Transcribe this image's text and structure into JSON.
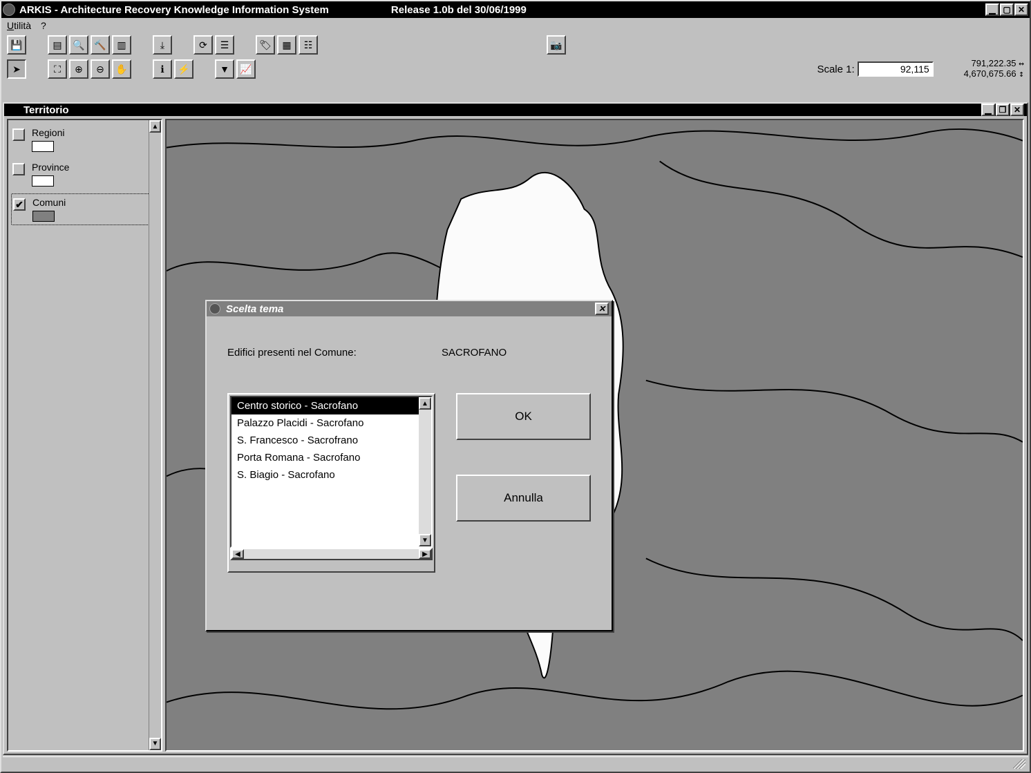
{
  "app": {
    "title": "ARKIS - Architecture Recovery Knowledge Information System",
    "release": "Release 1.0b  del 30/06/1999"
  },
  "menu": {
    "utilita": "Utilità",
    "help": "?"
  },
  "scale": {
    "label": "Scale 1:",
    "value": "92,115"
  },
  "coords": {
    "x": "791,222.35",
    "y": "4,670,675.66"
  },
  "child": {
    "title": "Territorio"
  },
  "layers": [
    {
      "name": "Regioni",
      "checked": false,
      "swatch": "#ffffff",
      "selected": false
    },
    {
      "name": "Province",
      "checked": false,
      "swatch": "#ffffff",
      "selected": false
    },
    {
      "name": "Comuni",
      "checked": true,
      "swatch": "#808080",
      "selected": true
    }
  ],
  "map": {
    "label": "SACROFANO"
  },
  "dialog": {
    "title": "Scelta tema",
    "prompt": "Edifici presenti nel Comune:",
    "comune": "SACROFANO",
    "ok": "OK",
    "cancel": "Annulla",
    "items": [
      "Centro storico - Sacrofano",
      "Palazzo Placidi - Sacrofano",
      "S. Francesco - Sacrofrano",
      "Porta Romana - Sacrofano",
      "S. Biagio - Sacrofano"
    ],
    "selected_index": 0
  }
}
